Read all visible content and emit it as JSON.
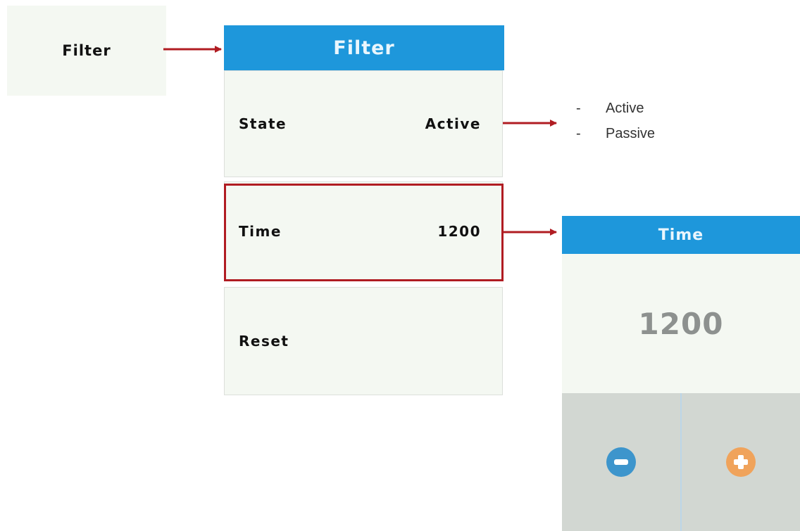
{
  "source_tile": {
    "label": "Filter"
  },
  "menu": {
    "title": "Filter",
    "rows": [
      {
        "label": "State",
        "value": "Active"
      },
      {
        "label": "Time",
        "value": "1200"
      },
      {
        "label": "Reset",
        "value": ""
      }
    ]
  },
  "state_options": [
    {
      "dash": "-",
      "label": "Active"
    },
    {
      "dash": "-",
      "label": "Passive"
    }
  ],
  "time_editor": {
    "title": "Time",
    "value": "1200",
    "decrement_icon": "minus-icon",
    "increment_icon": "plus-icon"
  },
  "colors": {
    "header_blue": "#1e97db",
    "highlight_red": "#b01c22",
    "panel_bg": "#f4f8f2",
    "button_bg": "#d2d7d2",
    "minus_blue": "#3d95cc",
    "plus_orange": "#f0a35b"
  }
}
